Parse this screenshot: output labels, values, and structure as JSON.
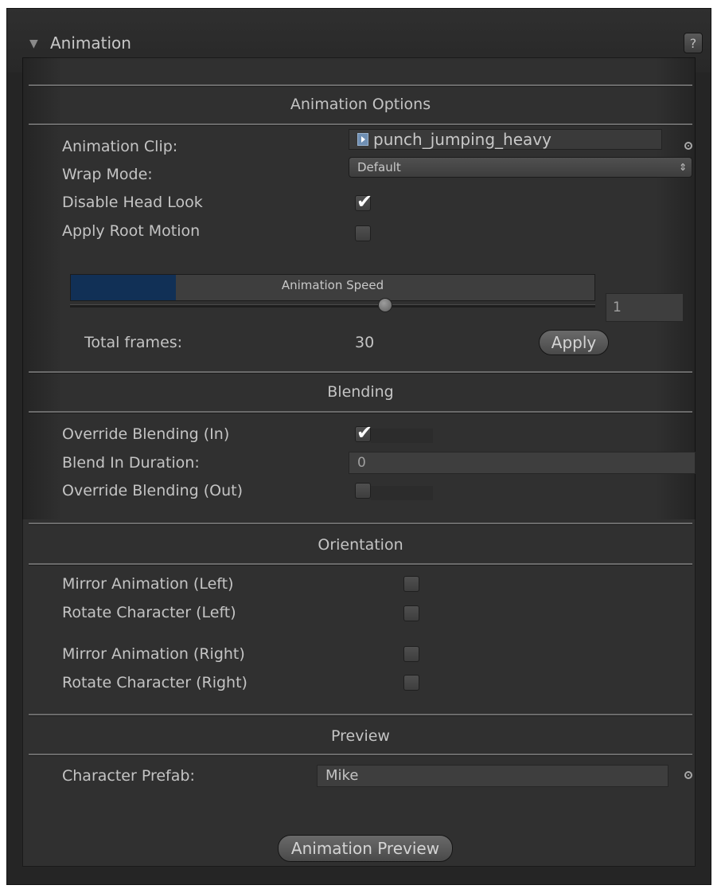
{
  "header": {
    "title": "Animation",
    "help_label": "?"
  },
  "animation_options": {
    "section_title": "Animation Options",
    "clip_label": "Animation Clip:",
    "clip_value": "punch_jumping_heavy",
    "wrap_mode_label": "Wrap Mode:",
    "wrap_mode_value": "Default",
    "disable_head_look_label": "Disable Head Look",
    "disable_head_look_checked": true,
    "apply_root_motion_label": "Apply Root Motion",
    "apply_root_motion_checked": false,
    "speed_label": "Animation Speed",
    "speed_value": "1",
    "speed_fill_fraction": 0.2,
    "speed_slider_fraction": 0.6,
    "total_frames_label": "Total frames:",
    "total_frames_value": "30",
    "apply_label": "Apply"
  },
  "blending": {
    "section_title": "Blending",
    "override_in_label": "Override Blending (In)",
    "override_in_checked": true,
    "blend_in_duration_label": "Blend In Duration:",
    "blend_in_duration_value": "0",
    "override_out_label": "Override Blending (Out)",
    "override_out_checked": false
  },
  "orientation": {
    "section_title": "Orientation",
    "mirror_left_label": "Mirror Animation (Left)",
    "rotate_left_label": "Rotate Character (Left)",
    "mirror_right_label": "Mirror Animation (Right)",
    "rotate_right_label": "Rotate Character (Right)"
  },
  "preview": {
    "section_title": "Preview",
    "character_prefab_label": "Character Prefab:",
    "character_prefab_value": "Mike",
    "animation_preview_label": "Animation Preview"
  },
  "icons": {
    "collapse": "triangle-down-icon",
    "clip": "animation-clip-icon",
    "object_picker": "object-picker-icon",
    "dropdown": "updown-arrows-icon",
    "check": "checkmark-icon"
  }
}
